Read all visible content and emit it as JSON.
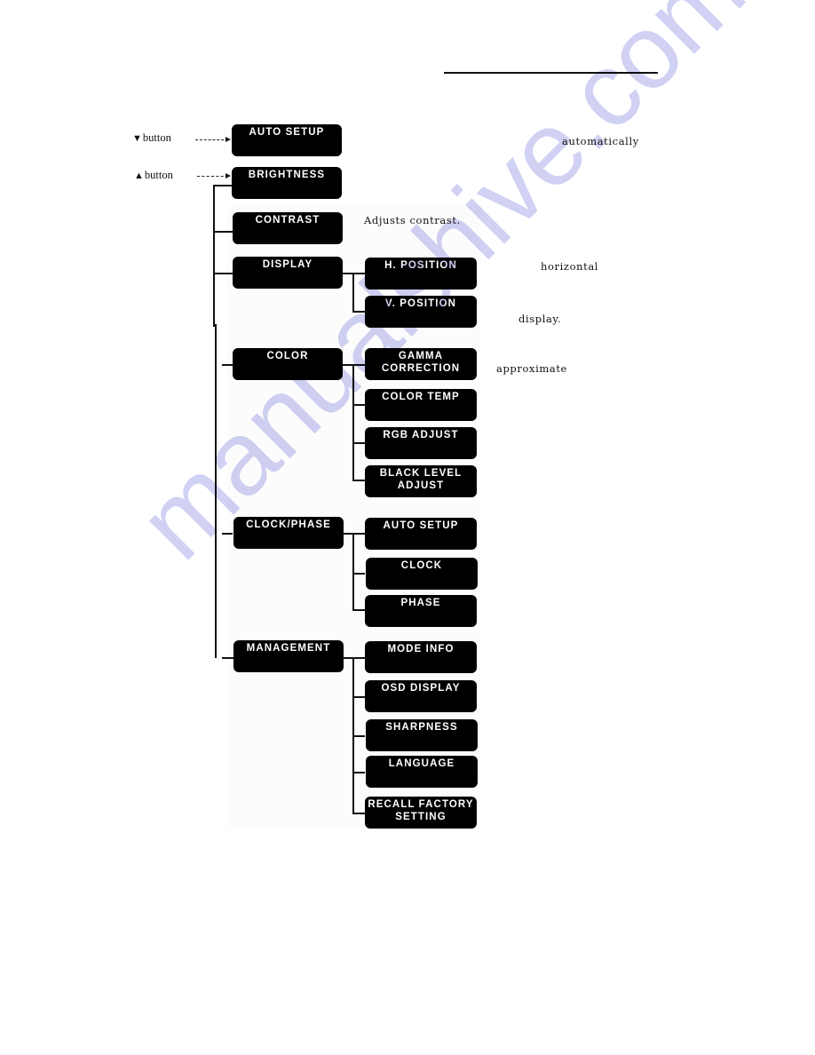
{
  "document": {
    "watermark": "manualshive.com",
    "button_labels": {
      "down": {
        "icon": "triangle-down-icon",
        "glyph": "▼",
        "label": "button"
      },
      "up": {
        "icon": "triangle-up-icon",
        "glyph": "▲",
        "label": "button"
      }
    },
    "notes": {
      "auto_setup": "automatically",
      "contrast": "Adjusts contrast.",
      "h_position": "horizontal",
      "v_position": "display.",
      "gamma": "approximate"
    }
  },
  "menu": {
    "auto_setup": "AUTO SETUP",
    "brightness": "BRIGHTNESS",
    "contrast": "CONTRAST",
    "display": {
      "label": "DISPLAY",
      "children": [
        "H. POSITION",
        "V. POSITION"
      ]
    },
    "color": {
      "label": "COLOR",
      "children": [
        "GAMMA\nCORRECTION",
        "COLOR TEMP",
        "RGB ADJUST",
        "BLACK LEVEL\nADJUST"
      ]
    },
    "clock_phase": {
      "label": "CLOCK/PHASE",
      "children": [
        "AUTO SETUP",
        "CLOCK",
        "PHASE"
      ]
    },
    "management": {
      "label": "MANAGEMENT",
      "children": [
        "MODE INFO",
        "OSD DISPLAY",
        "SHARPNESS",
        "LANGUAGE",
        "RECALL FACTORY\nSETTING"
      ]
    }
  }
}
